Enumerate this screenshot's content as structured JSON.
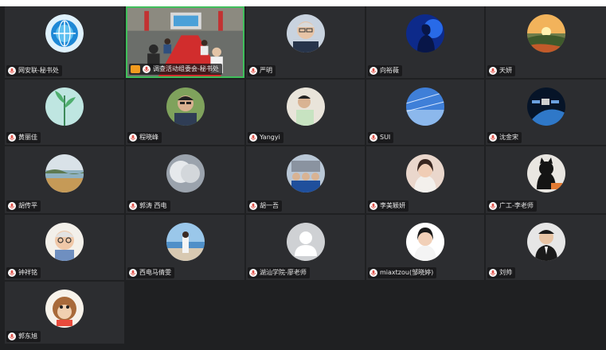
{
  "participants": [
    {
      "id": "p1",
      "name": "网安联-秘书处",
      "avatar": "globe-logo"
    },
    {
      "id": "p2",
      "name": "调查活动组委会-秘书处",
      "avatar": "live-video",
      "sharing": true
    },
    {
      "id": "p3",
      "name": "严明",
      "avatar": "man-glasses"
    },
    {
      "id": "p4",
      "name": "向裕薇",
      "avatar": "blue-silhouette"
    },
    {
      "id": "p5",
      "name": "天妍",
      "avatar": "sunset-landscape"
    },
    {
      "id": "p6",
      "name": "黄丽佳",
      "avatar": "green-plant"
    },
    {
      "id": "p7",
      "name": "程晓峰",
      "avatar": "man-outdoor"
    },
    {
      "id": "p8",
      "name": "Yangyi",
      "avatar": "person-white-shirt"
    },
    {
      "id": "p9",
      "name": "SUI",
      "avatar": "blue-sky"
    },
    {
      "id": "p10",
      "name": "沈金宋",
      "avatar": "satellite-earth"
    },
    {
      "id": "p11",
      "name": "胡传平",
      "avatar": "beach-landscape"
    },
    {
      "id": "p12",
      "name": "郭涛 西电",
      "avatar": "cloud-grey"
    },
    {
      "id": "p13",
      "name": "胡一吾",
      "avatar": "group-photo"
    },
    {
      "id": "p14",
      "name": "李美颖妍",
      "avatar": "girl-portrait"
    },
    {
      "id": "p15",
      "name": "广工-李老师",
      "avatar": "black-cat"
    },
    {
      "id": "p16",
      "name": "钟祥铭",
      "avatar": "cartoon-grandpa"
    },
    {
      "id": "p17",
      "name": "西电马倩雯",
      "avatar": "woman-seaside"
    },
    {
      "id": "p18",
      "name": "湖汕学院-廖老师",
      "avatar": "default-user"
    },
    {
      "id": "p19",
      "name": "miaxtzou(邹晓婷)",
      "avatar": "woman-white"
    },
    {
      "id": "p20",
      "name": "刘帅",
      "avatar": "man-suit"
    },
    {
      "id": "p21",
      "name": "郭东旭",
      "avatar": "cartoon-monkey"
    }
  ],
  "colors": {
    "stage": "#1f2022",
    "tile": "#2c2d30",
    "active_border": "#3fbf5b",
    "mic": "#e0534a"
  },
  "icons": {
    "mic": "microphone-icon",
    "share": "screen-share-icon"
  }
}
